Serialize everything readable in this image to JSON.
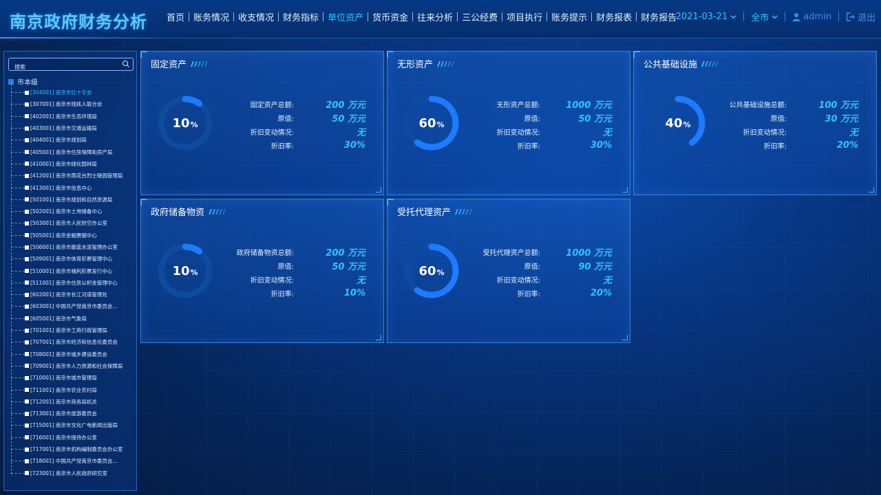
{
  "app": {
    "title": "南京政府财务分析"
  },
  "nav": [
    {
      "label": "首页",
      "active": false
    },
    {
      "label": "账务情况",
      "active": false
    },
    {
      "label": "收支情况",
      "active": false
    },
    {
      "label": "财务指标",
      "active": false
    },
    {
      "label": "单位资产",
      "active": true
    },
    {
      "label": "货币资金",
      "active": false
    },
    {
      "label": "往来分析",
      "active": false
    },
    {
      "label": "三公经费",
      "active": false
    },
    {
      "label": "项目执行",
      "active": false
    },
    {
      "label": "账务提示",
      "active": false
    },
    {
      "label": "财务报表",
      "active": false
    },
    {
      "label": "财务报告",
      "active": false
    }
  ],
  "header_right": {
    "date": "2021-03-21",
    "city": "全市",
    "user": "admin",
    "logout": "退出"
  },
  "sidebar": {
    "search_placeholder": "搜索",
    "root_label": "市本级",
    "items": [
      {
        "label": "[304001] 南京市红十字会",
        "active": true
      },
      {
        "label": "[307001] 南京市残疾人联合会",
        "active": false
      },
      {
        "label": "[402001] 南京市生态环境局",
        "active": false
      },
      {
        "label": "[403001] 南京市交通运输局",
        "active": false
      },
      {
        "label": "[404001] 南京市规划局",
        "active": false
      },
      {
        "label": "[405001] 南京市住房保障和房产局",
        "active": false
      },
      {
        "label": "[410001] 南京市绿化园林局",
        "active": false
      },
      {
        "label": "[412001] 南京市雨花台烈士陵园管理局",
        "active": false
      },
      {
        "label": "[413001] 南京市信息中心",
        "active": false
      },
      {
        "label": "[501001] 南京市规划和自然资源局",
        "active": false
      },
      {
        "label": "[502001] 南京市土地储备中心",
        "active": false
      },
      {
        "label": "[503001] 南京市人民防空办公室",
        "active": false
      },
      {
        "label": "[505001] 南京金融票据中心",
        "active": false
      },
      {
        "label": "[506001] 南京市散装水泥管理办公室",
        "active": false
      },
      {
        "label": "[509001] 南京市体育彩票管理中心",
        "active": false
      },
      {
        "label": "[510001] 南京市福利彩票发行中心",
        "active": false
      },
      {
        "label": "[511001] 南京市住房公积金管理中心",
        "active": false
      },
      {
        "label": "[602001] 南京市长江河道管理处",
        "active": false
      },
      {
        "label": "[603001] 中国共产党南京市委员会...",
        "active": false
      },
      {
        "label": "[605001] 南京市气象局",
        "active": false
      },
      {
        "label": "[701001] 南京市工商行政管理局",
        "active": false
      },
      {
        "label": "[707001] 南京市经济和信息化委员会",
        "active": false
      },
      {
        "label": "[708001] 南京市城乡建设委员会",
        "active": false
      },
      {
        "label": "[709001] 南京市人力资源和社会保障局",
        "active": false
      },
      {
        "label": "[710001] 南京市城市管理局",
        "active": false
      },
      {
        "label": "[711001] 南京市农业农村局",
        "active": false
      },
      {
        "label": "[712001] 南京市商务局机关",
        "active": false
      },
      {
        "label": "[713001] 南京市旅游委员会",
        "active": false
      },
      {
        "label": "[715001] 南京市文化广电新闻出版局",
        "active": false
      },
      {
        "label": "[716001] 南京市接待办公室",
        "active": false
      },
      {
        "label": "[717001] 南京市机构编制委员会办公室",
        "active": false
      },
      {
        "label": "[718001] 中国共产党南京市委员会...",
        "active": false
      },
      {
        "label": "[723001] 南京市人民政府研究室",
        "active": false
      }
    ]
  },
  "cards": [
    {
      "title": "固定资产",
      "percent": 10,
      "percent_text": "10",
      "unit": "%",
      "stats": [
        {
          "label": "固定资产总额:",
          "value": "200 万元"
        },
        {
          "label": "原值:",
          "value": "50 万元"
        },
        {
          "label": "折旧变动情况:",
          "value": "无"
        },
        {
          "label": "折旧率:",
          "value": "30%"
        }
      ]
    },
    {
      "title": "无形资产",
      "percent": 60,
      "percent_text": "60",
      "unit": "%",
      "stats": [
        {
          "label": "无形资产总额:",
          "value": "1000 万元"
        },
        {
          "label": "原值:",
          "value": "50 万元"
        },
        {
          "label": "折旧变动情况:",
          "value": "无"
        },
        {
          "label": "折旧率:",
          "value": "30%"
        }
      ]
    },
    {
      "title": "公共基础设施",
      "percent": 40,
      "percent_text": "40",
      "unit": "%",
      "stats": [
        {
          "label": "公共基础设施总额:",
          "value": "100 万元"
        },
        {
          "label": "原值:",
          "value": "30 万元"
        },
        {
          "label": "折旧变动情况:",
          "value": "无"
        },
        {
          "label": "折旧率:",
          "value": "20%"
        }
      ]
    },
    {
      "title": "政府储备物资",
      "percent": 10,
      "percent_text": "10",
      "unit": "%",
      "stats": [
        {
          "label": "政府储备物资总额:",
          "value": "200 万元"
        },
        {
          "label": "原值:",
          "value": "50 万元"
        },
        {
          "label": "折旧变动情况:",
          "value": "无"
        },
        {
          "label": "折旧率:",
          "value": "10%"
        }
      ]
    },
    {
      "title": "受托代理资产",
      "percent": 60,
      "percent_text": "60",
      "unit": "%",
      "stats": [
        {
          "label": "受托代理资产总额:",
          "value": "1000 万元"
        },
        {
          "label": "原值:",
          "value": "90 万元"
        },
        {
          "label": "折旧变动情况:",
          "value": "无"
        },
        {
          "label": "折旧率:",
          "value": "20%"
        }
      ]
    }
  ],
  "colors": {
    "accent": "#2ec4ff",
    "ring_track": "#0e4a9e",
    "ring_fill": "#1e7bff",
    "nav_active": "#2ec4ff"
  },
  "icons": {
    "date_dropdown": "chevron-down-icon",
    "city_dropdown": "chevron-down-icon",
    "user": "user-icon",
    "logout": "logout-icon",
    "search": "search-icon"
  }
}
